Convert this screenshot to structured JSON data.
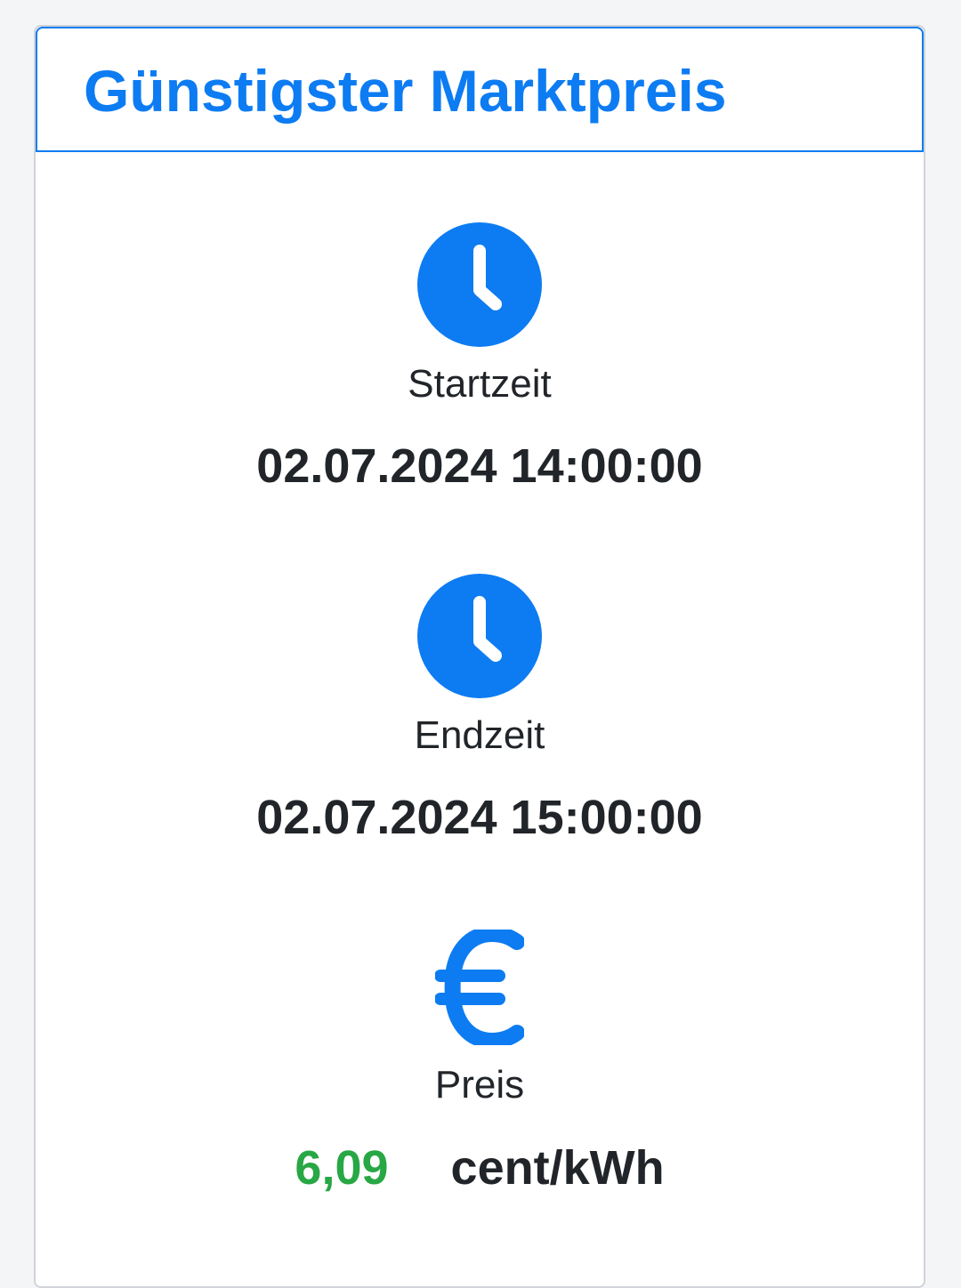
{
  "card": {
    "title": "Günstigster Marktpreis"
  },
  "start": {
    "icon": "clock-icon",
    "label": "Startzeit",
    "value": "02.07.2024 14:00:00"
  },
  "end": {
    "icon": "clock-icon",
    "label": "Endzeit",
    "value": "02.07.2024 15:00:00"
  },
  "price": {
    "icon": "euro-icon",
    "label": "Preis",
    "value": "6,09",
    "unit": "cent/kWh"
  },
  "colors": {
    "accent": "#0d7cf2",
    "price_value": "#28a745",
    "text": "#212529"
  }
}
